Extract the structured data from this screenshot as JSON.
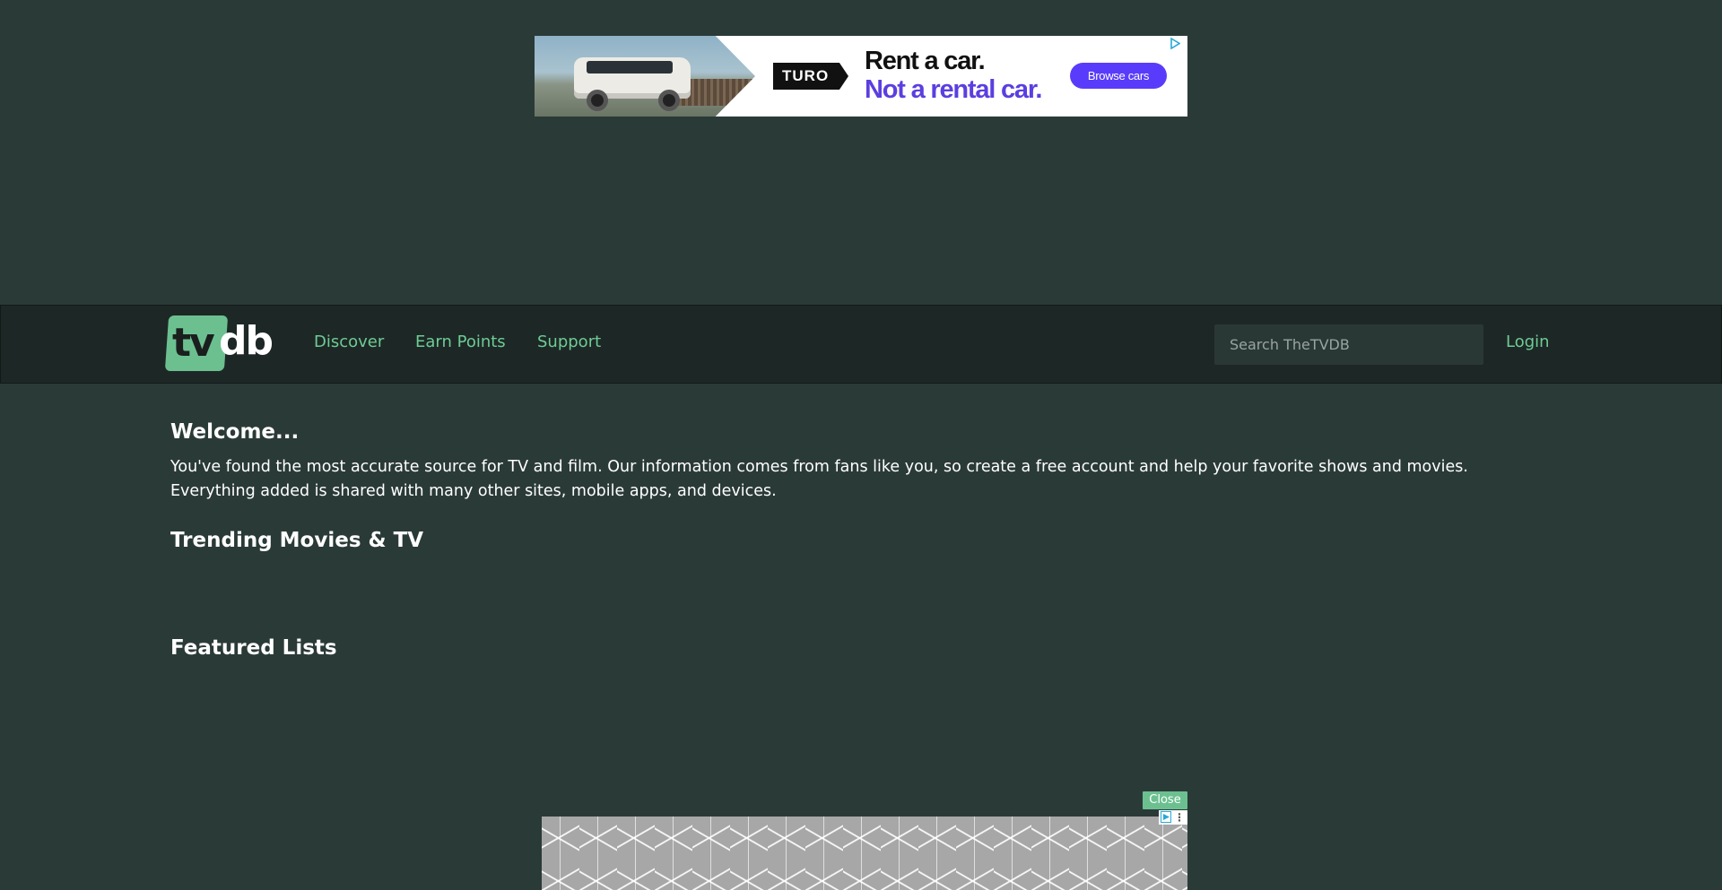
{
  "top_ad": {
    "brand": "TURO",
    "headline_line1": "Rent a car.",
    "headline_line2": "Not a rental car.",
    "cta_label": "Browse cars",
    "adchoice_icon": "play-triangle-icon"
  },
  "navbar": {
    "logo_tv": "tv",
    "logo_db": "db",
    "links": [
      {
        "label": "Discover"
      },
      {
        "label": "Earn Points"
      },
      {
        "label": "Support"
      }
    ],
    "search": {
      "placeholder": "Search TheTVDB",
      "value": ""
    },
    "login_label": "Login"
  },
  "main": {
    "welcome_title": "Welcome...",
    "welcome_text": "You've found the most accurate source for TV and film. Our information comes from fans like you, so create a free account and help your favorite shows and movies. Everything added is shared with many other sites, mobile apps, and devices.",
    "trending_title": "Trending Movies & TV",
    "featured_title": "Featured Lists"
  },
  "bottom_ad": {
    "close_label": "Close",
    "adchoice_icon": "play-triangle-icon",
    "menu_icon": "vertical-dots-icon"
  },
  "colors": {
    "page_bg": "#2a3a37",
    "navbar_bg": "#1d2826",
    "accent_green": "#6fcb95",
    "turo_purple": "#593cfb"
  }
}
